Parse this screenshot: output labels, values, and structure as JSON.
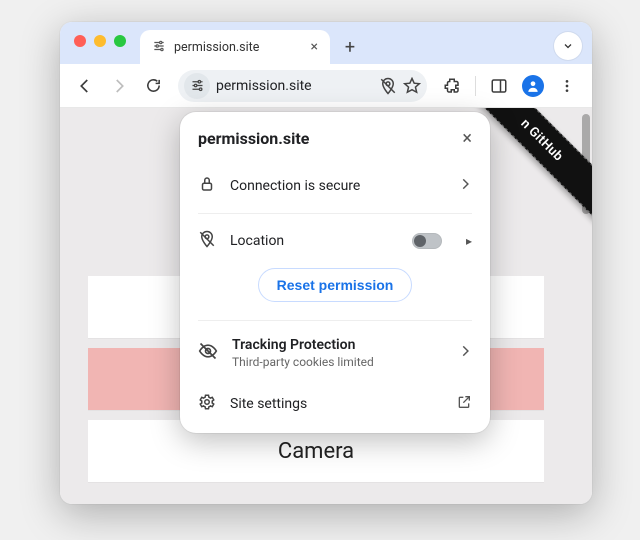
{
  "tab": {
    "title": "permission.site",
    "favicon_name": "tune-icon"
  },
  "toolbar": {
    "url_display": "permission.site"
  },
  "page": {
    "ribbon_text": "n GitHub",
    "cards": {
      "notifications": "",
      "location": "",
      "camera": "Camera"
    }
  },
  "popover": {
    "site": "permission.site",
    "connection_label": "Connection is secure",
    "location_label": "Location",
    "location_enabled": false,
    "reset_label": "Reset permission",
    "tracking_label": "Tracking Protection",
    "tracking_sub": "Third-party cookies limited",
    "site_settings_label": "Site settings"
  }
}
